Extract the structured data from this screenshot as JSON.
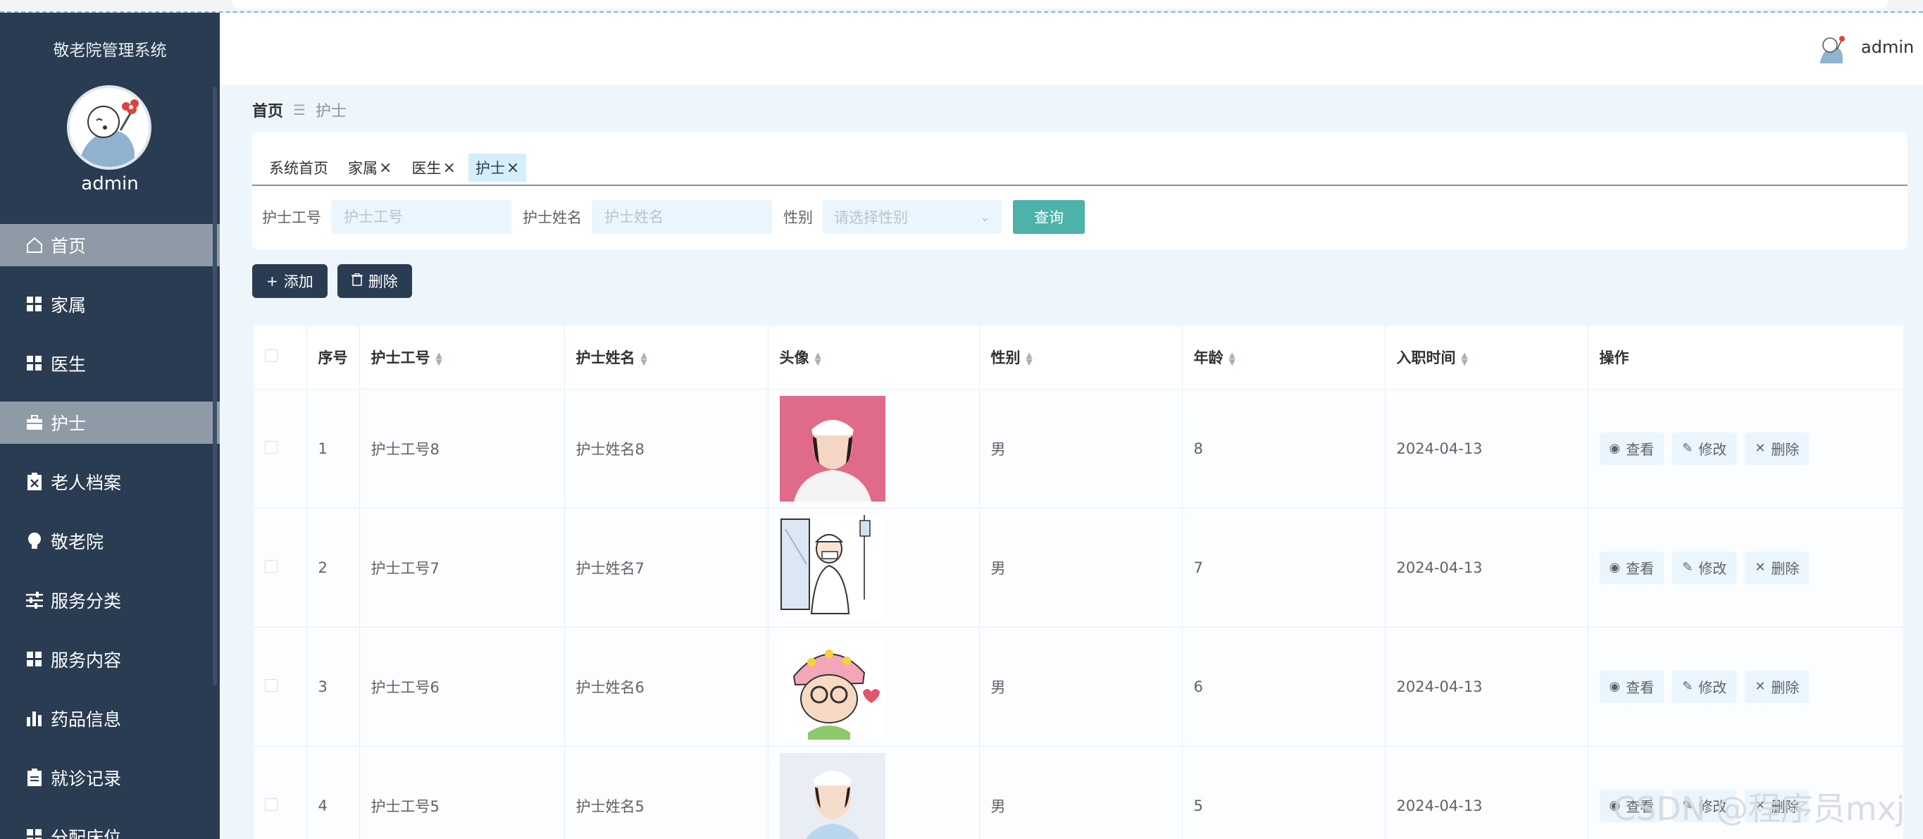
{
  "app": {
    "title": "敬老院管理系统",
    "user": "admin"
  },
  "sidebar": {
    "items": [
      {
        "label": "首页",
        "icon": "home-icon",
        "active": true
      },
      {
        "label": "家属",
        "icon": "grid-icon"
      },
      {
        "label": "医生",
        "icon": "grid-icon"
      },
      {
        "label": "护士",
        "icon": "briefcase-icon",
        "active": true
      },
      {
        "label": "老人档案",
        "icon": "clipboard-x-icon"
      },
      {
        "label": "敬老院",
        "icon": "bulb-icon"
      },
      {
        "label": "服务分类",
        "icon": "sliders-icon"
      },
      {
        "label": "服务内容",
        "icon": "grid-icon"
      },
      {
        "label": "药品信息",
        "icon": "bar-chart-icon"
      },
      {
        "label": "就诊记录",
        "icon": "clipboard-icon"
      },
      {
        "label": "分配床位",
        "icon": "grid-icon"
      }
    ]
  },
  "header": {
    "user": "admin"
  },
  "breadcrumb": {
    "home": "首页",
    "separator": "☰",
    "current": "护士"
  },
  "tabs": [
    {
      "label": "系统首页",
      "closable": false
    },
    {
      "label": "家属",
      "closable": true
    },
    {
      "label": "医生",
      "closable": true
    },
    {
      "label": "护士",
      "closable": true,
      "active": true
    }
  ],
  "tab_close": "×",
  "search": {
    "no_label": "护士工号",
    "no_placeholder": "护士工号",
    "name_label": "护士姓名",
    "name_placeholder": "护士姓名",
    "gender_label": "性别",
    "gender_placeholder": "请选择性别",
    "query_button": "查询"
  },
  "actions": {
    "add": "添加",
    "delete": "删除"
  },
  "table": {
    "columns": [
      "序号",
      "护士工号",
      "护士姓名",
      "头像",
      "性别",
      "年龄",
      "入职时间",
      "操作"
    ],
    "rows": [
      {
        "index": "1",
        "no": "护士工号8",
        "name": "护士姓名8",
        "gender": "男",
        "age": "8",
        "date": "2024-04-13"
      },
      {
        "index": "2",
        "no": "护士工号7",
        "name": "护士姓名7",
        "gender": "男",
        "age": "7",
        "date": "2024-04-13"
      },
      {
        "index": "3",
        "no": "护士工号6",
        "name": "护士姓名6",
        "gender": "男",
        "age": "6",
        "date": "2024-04-13"
      },
      {
        "index": "4",
        "no": "护士工号5",
        "name": "护士姓名5",
        "gender": "男",
        "age": "5",
        "date": "2024-04-13"
      }
    ],
    "ops": {
      "view": "查看",
      "edit": "修改",
      "delete": "删除"
    }
  },
  "watermark": "CSDN @程序员mxj",
  "colors": {
    "sidebar": "#293c52",
    "active_menu": "#8e9aa6",
    "query": "#4cb2aa",
    "page_bg": "#eef6fc"
  }
}
